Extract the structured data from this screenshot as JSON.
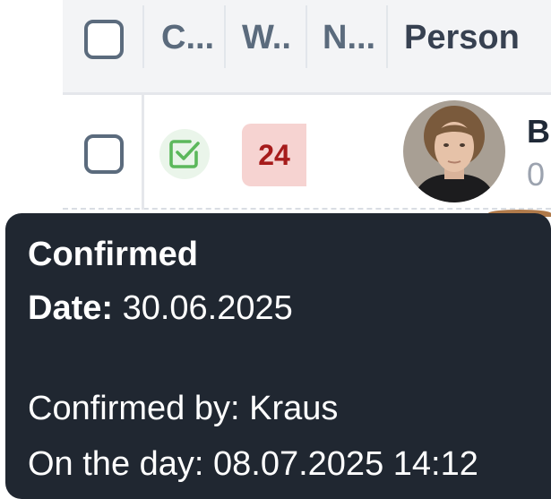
{
  "header": {
    "col_confirmed": "C...",
    "col_week": "W..",
    "col_note": "N...",
    "col_person": "Person"
  },
  "row": {
    "week_number": "24",
    "person_name_partial": "B",
    "person_sub_partial": "0",
    "confirmed": true
  },
  "tooltip": {
    "title": "Confirmed",
    "date_label": "Date:",
    "date_value": "30.06.2025",
    "confirmed_by": "Confirmed by: Kraus",
    "on_the_day": "On the day: 08.07.2025 14:12"
  },
  "colors": {
    "tooltip_bg": "#202731",
    "badge_bg": "#f6d3d1",
    "badge_text": "#a61b1b",
    "confirm_green": "#5cb85c"
  },
  "icons": {
    "confirmed": "check-square-icon"
  }
}
